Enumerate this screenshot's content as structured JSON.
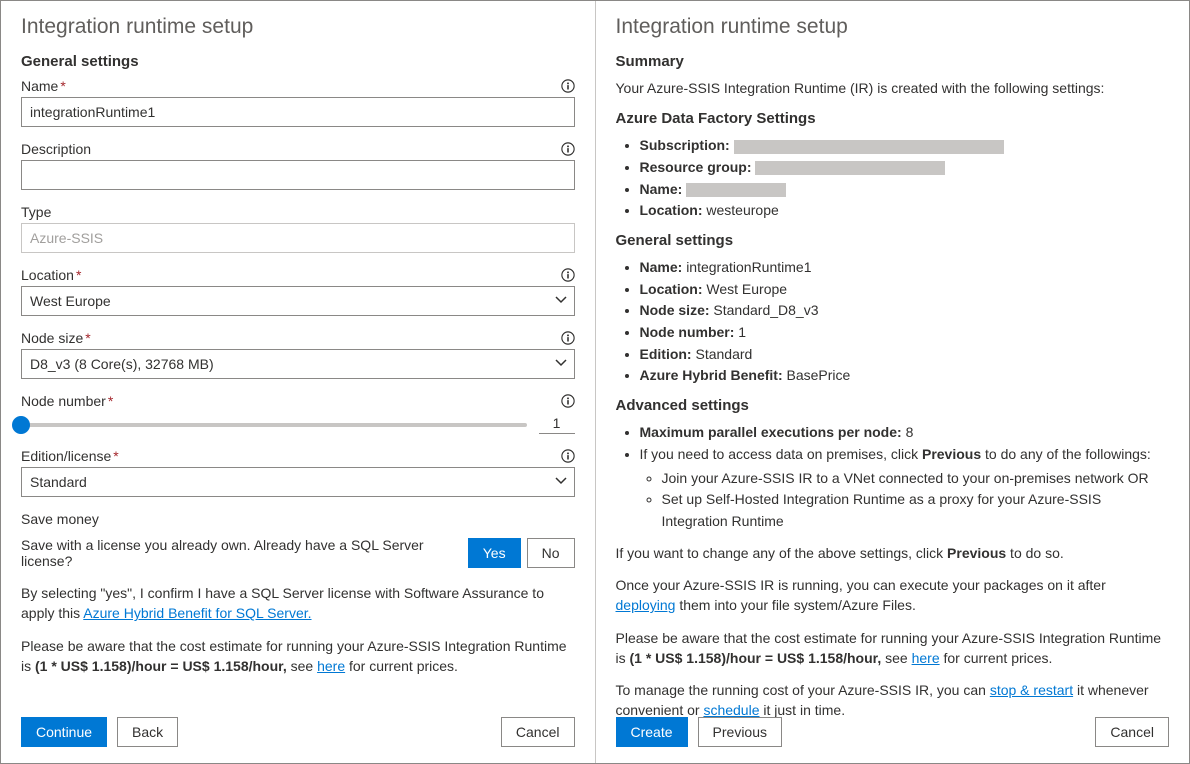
{
  "left": {
    "title": "Integration runtime setup",
    "generalHeading": "General settings",
    "name": {
      "label": "Name",
      "value": "integrationRuntime1"
    },
    "description": {
      "label": "Description",
      "value": ""
    },
    "type": {
      "label": "Type",
      "value": "Azure-SSIS"
    },
    "location": {
      "label": "Location",
      "value": "West Europe"
    },
    "nodeSize": {
      "label": "Node size",
      "value": "D8_v3 (8 Core(s), 32768 MB)"
    },
    "nodeNumber": {
      "label": "Node number",
      "value": "1"
    },
    "edition": {
      "label": "Edition/license",
      "value": "Standard"
    },
    "saveMoneyHeading": "Save money",
    "saveMoneyQuestion": "Save with a license you already own. Already have a SQL Server license?",
    "yesLabel": "Yes",
    "noLabel": "No",
    "confirmPrefix": "By selecting \"yes\", I confirm I have a SQL Server license with Software Assurance to apply this ",
    "confirmLink": "Azure Hybrid Benefit for SQL Server.",
    "costPrefix": "Please be aware that the cost estimate for running your Azure-SSIS Integration Runtime is ",
    "costBold": "(1 * US$ 1.158)/hour = US$ 1.158/hour,",
    "costSee": " see ",
    "costHere": "here",
    "costSuffix": " for current prices.",
    "continueBtn": "Continue",
    "backBtn": "Back",
    "cancelBtn": "Cancel"
  },
  "right": {
    "title": "Integration runtime setup",
    "summaryHeading": "Summary",
    "summaryIntro": "Your Azure-SSIS Integration Runtime (IR) is created with the following settings:",
    "adfHeading": "Azure Data Factory Settings",
    "adf": {
      "subscriptionLabel": "Subscription:",
      "resourceGroupLabel": "Resource group:",
      "nameLabel": "Name:",
      "locationLabel": "Location:",
      "locationValue": "westeurope"
    },
    "generalHeading": "General settings",
    "general": {
      "nameLabel": "Name:",
      "nameValue": "integrationRuntime1",
      "locationLabel": "Location:",
      "locationValue": "West Europe",
      "nodeSizeLabel": "Node size:",
      "nodeSizeValue": "Standard_D8_v3",
      "nodeNumberLabel": "Node number:",
      "nodeNumberValue": "1",
      "editionLabel": "Edition:",
      "editionValue": "Standard",
      "ahbLabel": "Azure Hybrid Benefit:",
      "ahbValue": "BasePrice"
    },
    "advancedHeading": "Advanced settings",
    "advanced": {
      "maxExecLabel": "Maximum parallel executions per node:",
      "maxExecValue": "8",
      "previousTextPre": "If you need to access data on premises, click ",
      "previousBold": "Previous",
      "previousTextPost": " to do any of the followings:",
      "opt1": "Join your Azure-SSIS IR to a VNet connected to your on-premises network OR",
      "opt2": "Set up Self-Hosted Integration Runtime as a proxy for your Azure-SSIS Integration Runtime"
    },
    "changePre": "If you want to change any of the above settings, click ",
    "changeBold": "Previous",
    "changePost": " to do so.",
    "runningPre": "Once your Azure-SSIS IR is running, you can execute your packages on it after ",
    "runningLink": "deploying",
    "runningPost": " them into your file system/Azure Files.",
    "costPre": "Please be aware that the cost estimate for running your Azure-SSIS Integration Runtime is ",
    "costBold": "(1 * US$ 1.158)/hour = US$ 1.158/hour,",
    "costSee": " see ",
    "costHere": "here",
    "costPost": " for current prices.",
    "managePre": "To manage the running cost of your Azure-SSIS IR, you can ",
    "manageLink1": "stop & restart",
    "manageMid": " it whenever convenient or ",
    "manageLink2": "schedule",
    "managePost": " it just in time.",
    "createBtn": "Create",
    "previousBtn": "Previous",
    "cancelBtn": "Cancel"
  }
}
